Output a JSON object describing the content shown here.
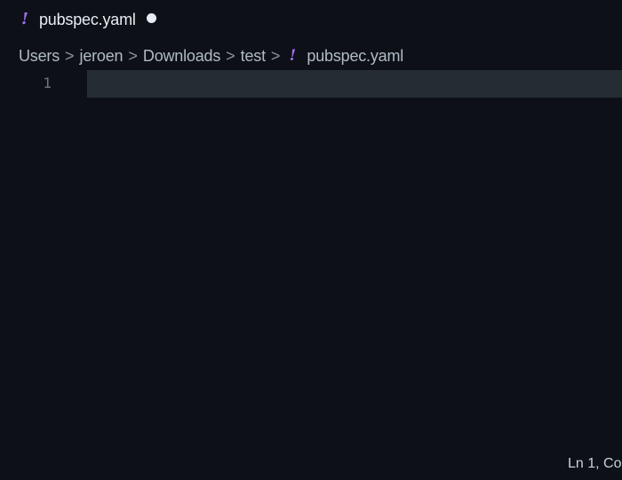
{
  "tab": {
    "icon": "yaml-file-icon",
    "icon_glyph": "!",
    "label": "pubspec.yaml",
    "dirty_indicator": "unsaved-dot"
  },
  "breadcrumb": {
    "items": [
      "Users",
      "jeroen",
      "Downloads",
      "test"
    ],
    "separator": ">",
    "file_icon_glyph": "!",
    "file": "pubspec.yaml"
  },
  "editor": {
    "line_numbers": [
      "1"
    ],
    "lines": [
      ""
    ]
  },
  "statusbar": {
    "cursor_position": "Ln 1, Co"
  },
  "colors": {
    "background": "#0d1117",
    "current_line": "#262c34",
    "yaml_icon": "#a371f7",
    "text": "#e6edf3"
  }
}
